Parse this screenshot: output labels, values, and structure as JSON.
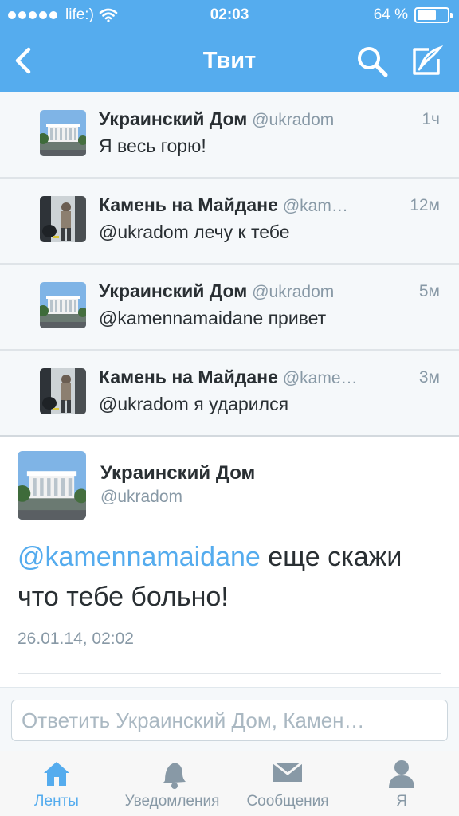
{
  "status_bar": {
    "carrier": "life:)",
    "time": "02:03",
    "battery": "64 %",
    "battery_level": 0.64
  },
  "nav": {
    "title": "Твит",
    "back_icon": "chevron-left-icon",
    "search_icon": "search-icon",
    "compose_icon": "compose-icon"
  },
  "conversation": [
    {
      "name": "Украинский Дом",
      "handle": "@ukradom",
      "time": "1ч",
      "text": "Я весь горю!"
    },
    {
      "name": "Камень на Майдане",
      "handle": "@kam…",
      "time": "12м",
      "text": "@ukradom лечу к тебе"
    },
    {
      "name": "Украинский Дом",
      "handle": "@ukradom",
      "time": "5м",
      "text": "@kamennamaidane привет"
    },
    {
      "name": "Камень на Майдане",
      "handle": "@kame…",
      "time": "3м",
      "text": "@ukradom я ударился"
    }
  ],
  "main_tweet": {
    "name": "Украинский Дом",
    "handle": "@ukradom",
    "mention": "@kamennamaidane",
    "text": " еще скажи что тебе больно!",
    "date": "26.01.14, 02:02"
  },
  "reply": {
    "placeholder": "Ответить Украинский Дом, Камен…"
  },
  "tabs": [
    {
      "label": "Ленты",
      "icon": "home-icon",
      "active": true
    },
    {
      "label": "Уведомления",
      "icon": "bell-icon",
      "active": false
    },
    {
      "label": "Сообщения",
      "icon": "envelope-icon",
      "active": false
    },
    {
      "label": "Я",
      "icon": "person-icon",
      "active": false
    }
  ],
  "colors": {
    "brand": "#55acee",
    "text": "#292f33",
    "muted": "#8899a6",
    "convo_bg": "#f5f8fa"
  }
}
